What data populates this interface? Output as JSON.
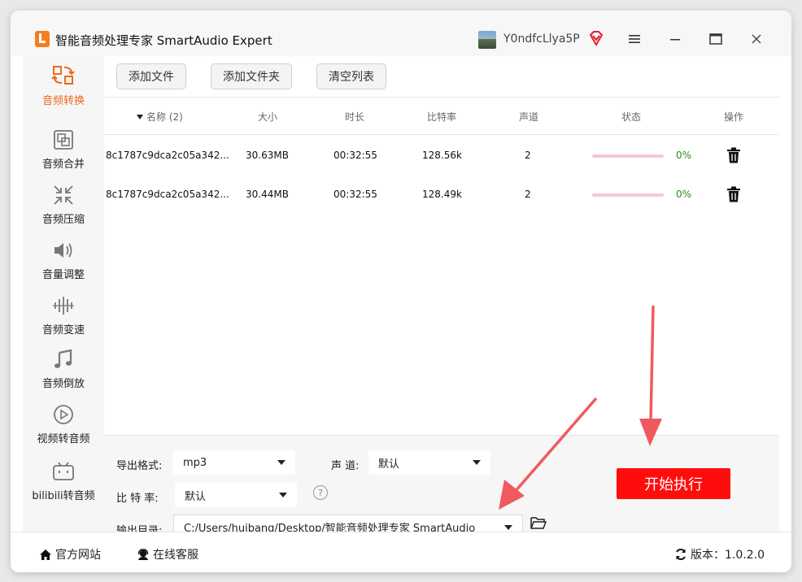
{
  "app": {
    "title": "智能音频处理专家 SmartAudio Expert"
  },
  "user": {
    "name": "Y0ndfcLlya5P"
  },
  "colors": {
    "accent": "#f0681d",
    "start_button": "#ff0d0d",
    "arrow": "#f05a5f",
    "progress_track": "#f2c9d4",
    "percent_text": "#2e8b1e"
  },
  "sidebar": {
    "items": [
      {
        "label": "音频转换",
        "icon": "audio-convert-icon",
        "active": true
      },
      {
        "label": "音频合并",
        "icon": "audio-merge-icon",
        "active": false
      },
      {
        "label": "音频压缩",
        "icon": "audio-compress-icon",
        "active": false
      },
      {
        "label": "音量调整",
        "icon": "volume-icon",
        "active": false
      },
      {
        "label": "音频变速",
        "icon": "audio-speed-icon",
        "active": false
      },
      {
        "label": "音频倒放",
        "icon": "music-note-icon",
        "active": false
      },
      {
        "label": "视频转音频",
        "icon": "play-circle-icon",
        "active": false
      },
      {
        "label": "bilibili转音频",
        "icon": "bilibili-tv-icon",
        "active": false
      }
    ]
  },
  "toolbar": {
    "add_file": "添加文件",
    "add_folder": "添加文件夹",
    "clear_list": "清空列表"
  },
  "table": {
    "headers": {
      "name": "名称 (2)",
      "size": "大小",
      "duration": "时长",
      "bitrate": "比特率",
      "channels": "声道",
      "status": "状态",
      "action": "操作"
    },
    "rows": [
      {
        "name": "8c1787c9dca2c05a342...",
        "size": "30.63MB",
        "duration": "00:32:55",
        "bitrate": "128.56k",
        "channels": "2",
        "progress": 0,
        "percent": "0%"
      },
      {
        "name": "8c1787c9dca2c05a342...",
        "size": "30.44MB",
        "duration": "00:32:55",
        "bitrate": "128.49k",
        "channels": "2",
        "progress": 0,
        "percent": "0%"
      }
    ]
  },
  "settings": {
    "format_label": "导出格式:",
    "format_value": "mp3",
    "channel_label": "声 道:",
    "channel_value": "默认",
    "bitrate_label": "比 特 率:",
    "bitrate_value": "默认",
    "output_label": "输出目录:",
    "output_value": "C:/Users/huibang/Desktop/智能音频处理专家 SmartAudio",
    "help": "?",
    "start_label": "开始执行"
  },
  "footer": {
    "website": "官方网站",
    "support": "在线客服",
    "version": "版本：1.0.2.0"
  }
}
